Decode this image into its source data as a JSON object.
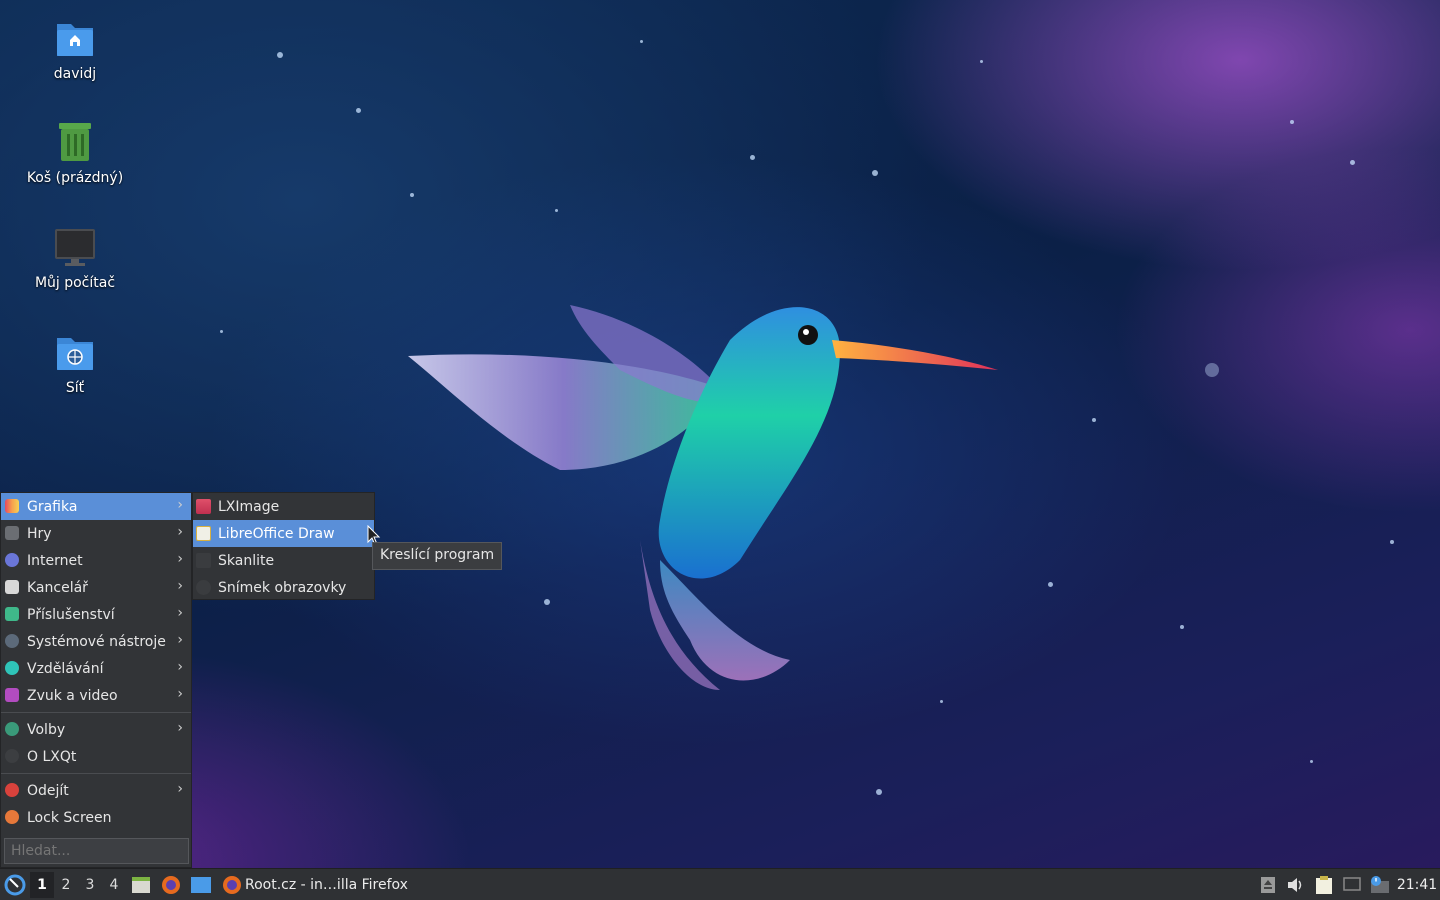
{
  "desktop": {
    "icons": [
      {
        "label": "davidj",
        "icon": "home-folder-icon"
      },
      {
        "label": "Koš (prázdný)",
        "icon": "trash-icon"
      },
      {
        "label": "Můj počítač",
        "icon": "computer-icon"
      },
      {
        "label": "Síť",
        "icon": "network-folder-icon"
      }
    ]
  },
  "menu": {
    "items": [
      {
        "label": "Grafika",
        "icon": "graphics-icon",
        "submenu": true,
        "active": true
      },
      {
        "label": "Hry",
        "icon": "games-icon",
        "submenu": true
      },
      {
        "label": "Internet",
        "icon": "internet-icon",
        "submenu": true
      },
      {
        "label": "Kancelář",
        "icon": "office-icon",
        "submenu": true
      },
      {
        "label": "Příslušenství",
        "icon": "accessories-icon",
        "submenu": true
      },
      {
        "label": "Systémové nástroje",
        "icon": "system-tools-icon",
        "submenu": true
      },
      {
        "label": "Vzdělávání",
        "icon": "education-icon",
        "submenu": true
      },
      {
        "label": "Zvuk a video",
        "icon": "multimedia-icon",
        "submenu": true
      }
    ],
    "settings": [
      {
        "label": "Volby",
        "icon": "preferences-icon",
        "submenu": true
      },
      {
        "label": "O LXQt",
        "icon": "about-icon",
        "submenu": false
      }
    ],
    "session": [
      {
        "label": "Odejít",
        "icon": "leave-icon",
        "submenu": true
      },
      {
        "label": "Lock Screen",
        "icon": "lock-icon",
        "submenu": false
      }
    ],
    "search_placeholder": "Hledat..."
  },
  "submenu": {
    "items": [
      {
        "label": "LXImage",
        "icon": "image-viewer-icon"
      },
      {
        "label": "LibreOffice Draw",
        "icon": "libreoffice-draw-icon",
        "active": true
      },
      {
        "label": "Skanlite",
        "icon": "scanner-icon"
      },
      {
        "label": "Snímek obrazovky",
        "icon": "screenshot-icon"
      }
    ]
  },
  "tooltip": "Kreslící program",
  "taskbar": {
    "desktops": [
      "1",
      "2",
      "3",
      "4"
    ],
    "current_desktop": "1",
    "quicklaunch": [
      "file-manager-icon",
      "firefox-icon",
      "show-desktop-icon"
    ],
    "task_label": "Root.cz - in…illa Firefox",
    "tray": [
      "removable-media-icon",
      "volume-icon",
      "clipboard-icon",
      "screen-icon",
      "network-notification-icon"
    ],
    "clock": "21:41"
  },
  "colors": {
    "menu_bg": "#323437",
    "highlight": "#5a8fd8",
    "taskbar_bg": "#2f3134"
  }
}
